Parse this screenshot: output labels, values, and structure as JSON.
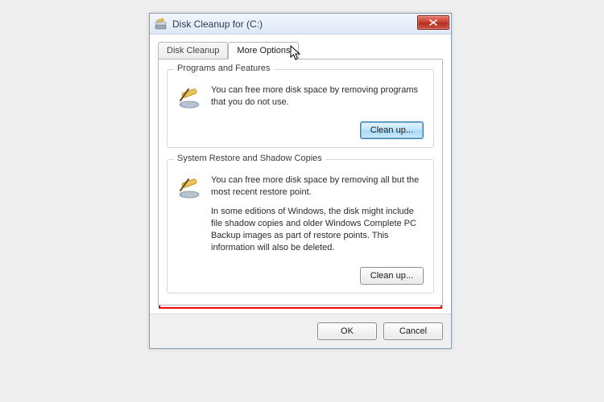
{
  "window": {
    "title": "Disk Cleanup for  (C:)"
  },
  "tabs": {
    "cleanup": "Disk Cleanup",
    "more": "More Options"
  },
  "groups": {
    "programs": {
      "legend": "Programs and Features",
      "desc": "You can free more disk space by removing programs that you do not use.",
      "button": "Clean up..."
    },
    "restore": {
      "legend": "System Restore and Shadow Copies",
      "desc1": "You can free more disk space by removing all but the most recent restore point.",
      "desc2": "In some editions of Windows, the disk might include file shadow copies and older Windows Complete PC Backup images as part of restore points. This information will also be deleted.",
      "button": "Clean up..."
    }
  },
  "footer": {
    "ok": "OK",
    "cancel": "Cancel"
  }
}
